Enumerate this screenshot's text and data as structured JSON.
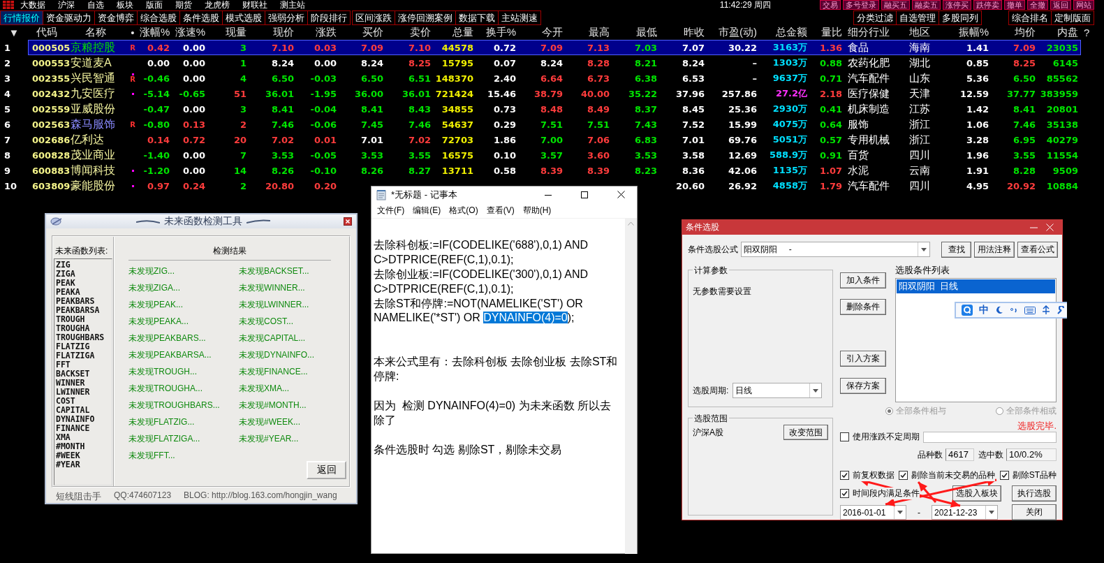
{
  "top_bar": {
    "menu": [
      "大数据",
      "沪深",
      "自选",
      "板块",
      "版面",
      "期货",
      "龙虎榜",
      "财联社",
      "测主站"
    ],
    "clock": "11:42:29 周四",
    "actions": [
      "交易",
      "多号登录",
      "融买五",
      "融卖五",
      "涨停买",
      "跌停卖",
      "撤单",
      "全撤",
      "返回",
      "网站"
    ]
  },
  "tab_groups": [
    [
      {
        "label": "行情报价",
        "selected": true
      },
      {
        "label": "资金驱动力",
        "selected": false
      },
      {
        "label": "资金博弈",
        "selected": false
      },
      {
        "label": "综合选股",
        "selected": false
      },
      {
        "label": "条件选股",
        "selected": false
      },
      {
        "label": "模式选股",
        "selected": false
      },
      {
        "label": "强弱分析",
        "selected": false
      },
      {
        "label": "阶段排行",
        "selected": false
      }
    ],
    [
      {
        "label": "区间涨跌",
        "selected": false
      },
      {
        "label": "涨停回溯案例",
        "selected": false
      },
      {
        "label": "数据下载",
        "selected": false
      },
      {
        "label": "主站测速",
        "selected": false
      }
    ],
    [
      {
        "label": "分类过滤",
        "selected": false
      },
      {
        "label": "自选管理",
        "selected": false
      },
      {
        "label": "多股同列",
        "selected": false
      }
    ],
    [
      {
        "label": "综合排名",
        "selected": false
      },
      {
        "label": "定制版面",
        "selected": false
      }
    ]
  ],
  "table": {
    "columns": [
      "▼",
      "代码",
      "名称",
      "•",
      "涨幅%",
      "涨速%",
      "现量",
      "现价",
      "涨跌",
      "买价",
      "卖价",
      "总量",
      "换手%",
      "今开",
      "最高",
      "最低",
      "昨收",
      "市盈(动)",
      "总金额",
      "量比",
      "细分行业",
      "地区",
      "振幅%",
      "均价",
      "内盘"
    ],
    "help_mark": "?",
    "rows": [
      {
        "selected": true,
        "dot": false,
        "cells": [
          {
            "text": "1",
            "kind": "plain"
          },
          {
            "text": "000505",
            "kind": "code"
          },
          {
            "text": "京粮控股",
            "kind": "down"
          },
          {
            "text": "R",
            "kind": "flag"
          },
          {
            "text": "0.42",
            "kind": "up"
          },
          {
            "text": "0.00",
            "kind": "plain"
          },
          {
            "text": "3",
            "kind": "down"
          },
          {
            "text": "7.10",
            "kind": "up"
          },
          {
            "text": "0.03",
            "kind": "up"
          },
          {
            "text": "7.09",
            "kind": "up"
          },
          {
            "text": "7.10",
            "kind": "up"
          },
          {
            "text": "44578",
            "kind": "vol"
          },
          {
            "text": "0.72",
            "kind": "plain"
          },
          {
            "text": "7.09",
            "kind": "up"
          },
          {
            "text": "7.13",
            "kind": "up"
          },
          {
            "text": "7.03",
            "kind": "down"
          },
          {
            "text": "7.07",
            "kind": "plain"
          },
          {
            "text": "30.22",
            "kind": "plain"
          },
          {
            "text": "3163万",
            "kind": "amt"
          },
          {
            "text": "1.36",
            "kind": "up"
          },
          {
            "text": "食品",
            "kind": "plain"
          },
          {
            "text": "海南",
            "kind": "plain"
          },
          {
            "text": "1.41",
            "kind": "plain"
          },
          {
            "text": "7.09",
            "kind": "up"
          },
          {
            "text": "23035",
            "kind": "down"
          }
        ]
      },
      {
        "selected": false,
        "dot": false,
        "cells": [
          {
            "text": "2",
            "kind": "plain"
          },
          {
            "text": "000553",
            "kind": "code"
          },
          {
            "text": "安道麦A",
            "kind": "name"
          },
          null,
          {
            "text": "0.00",
            "kind": "plain"
          },
          {
            "text": "0.00",
            "kind": "plain"
          },
          {
            "text": "1",
            "kind": "down"
          },
          {
            "text": "8.24",
            "kind": "plain"
          },
          {
            "text": "0.00",
            "kind": "plain"
          },
          {
            "text": "8.24",
            "kind": "plain"
          },
          {
            "text": "8.25",
            "kind": "up"
          },
          {
            "text": "15795",
            "kind": "vol"
          },
          {
            "text": "0.07",
            "kind": "plain"
          },
          {
            "text": "8.24",
            "kind": "plain"
          },
          {
            "text": "8.28",
            "kind": "up"
          },
          {
            "text": "8.21",
            "kind": "down"
          },
          {
            "text": "8.24",
            "kind": "plain"
          },
          {
            "text": "–",
            "kind": "plain"
          },
          {
            "text": "1303万",
            "kind": "amt"
          },
          {
            "text": "0.88",
            "kind": "down"
          },
          {
            "text": "农药化肥",
            "kind": "plain"
          },
          {
            "text": "湖北",
            "kind": "plain"
          },
          {
            "text": "0.85",
            "kind": "plain"
          },
          {
            "text": "8.25",
            "kind": "up"
          },
          {
            "text": "6145",
            "kind": "down"
          }
        ]
      },
      {
        "selected": false,
        "dot": true,
        "cells": [
          {
            "text": "3",
            "kind": "plain"
          },
          {
            "text": "002355",
            "kind": "code"
          },
          {
            "text": "兴民智通",
            "kind": "name"
          },
          {
            "text": "R",
            "kind": "flag"
          },
          {
            "text": "-0.46",
            "kind": "down"
          },
          {
            "text": "0.00",
            "kind": "plain"
          },
          {
            "text": "4",
            "kind": "down"
          },
          {
            "text": "6.50",
            "kind": "down"
          },
          {
            "text": "-0.03",
            "kind": "down"
          },
          {
            "text": "6.50",
            "kind": "down"
          },
          {
            "text": "6.51",
            "kind": "down"
          },
          {
            "text": "148370",
            "kind": "vol"
          },
          {
            "text": "2.40",
            "kind": "plain"
          },
          {
            "text": "6.64",
            "kind": "up"
          },
          {
            "text": "6.73",
            "kind": "up"
          },
          {
            "text": "6.38",
            "kind": "down"
          },
          {
            "text": "6.53",
            "kind": "plain"
          },
          {
            "text": "–",
            "kind": "plain"
          },
          {
            "text": "9637万",
            "kind": "amt"
          },
          {
            "text": "0.71",
            "kind": "down"
          },
          {
            "text": "汽车配件",
            "kind": "plain"
          },
          {
            "text": "山东",
            "kind": "plain"
          },
          {
            "text": "5.36",
            "kind": "plain"
          },
          {
            "text": "6.50",
            "kind": "down"
          },
          {
            "text": "85562",
            "kind": "down"
          }
        ]
      },
      {
        "selected": false,
        "dot": true,
        "cells": [
          {
            "text": "4",
            "kind": "plain"
          },
          {
            "text": "002432",
            "kind": "code"
          },
          {
            "text": "九安医疗",
            "kind": "name"
          },
          null,
          {
            "text": "-5.14",
            "kind": "down"
          },
          {
            "text": "-0.65",
            "kind": "down"
          },
          {
            "text": "51",
            "kind": "up"
          },
          {
            "text": "36.01",
            "kind": "down"
          },
          {
            "text": "-1.95",
            "kind": "down"
          },
          {
            "text": "36.00",
            "kind": "down"
          },
          {
            "text": "36.01",
            "kind": "down"
          },
          {
            "text": "721424",
            "kind": "vol"
          },
          {
            "text": "15.46",
            "kind": "plain"
          },
          {
            "text": "38.79",
            "kind": "up"
          },
          {
            "text": "40.00",
            "kind": "up"
          },
          {
            "text": "35.22",
            "kind": "down"
          },
          {
            "text": "37.96",
            "kind": "plain"
          },
          {
            "text": "257.86",
            "kind": "plain"
          },
          {
            "text": "27.2亿",
            "kind": "hot"
          },
          {
            "text": "2.18",
            "kind": "up"
          },
          {
            "text": "医疗保健",
            "kind": "plain"
          },
          {
            "text": "天津",
            "kind": "plain"
          },
          {
            "text": "12.59",
            "kind": "plain"
          },
          {
            "text": "37.77",
            "kind": "down"
          },
          {
            "text": "383959",
            "kind": "down"
          }
        ]
      },
      {
        "selected": false,
        "dot": false,
        "cells": [
          {
            "text": "5",
            "kind": "plain"
          },
          {
            "text": "002559",
            "kind": "code"
          },
          {
            "text": "亚威股份",
            "kind": "name"
          },
          null,
          {
            "text": "-0.47",
            "kind": "down"
          },
          {
            "text": "0.00",
            "kind": "plain"
          },
          {
            "text": "3",
            "kind": "down"
          },
          {
            "text": "8.41",
            "kind": "down"
          },
          {
            "text": "-0.04",
            "kind": "down"
          },
          {
            "text": "8.41",
            "kind": "down"
          },
          {
            "text": "8.43",
            "kind": "down"
          },
          {
            "text": "34855",
            "kind": "vol"
          },
          {
            "text": "0.73",
            "kind": "plain"
          },
          {
            "text": "8.48",
            "kind": "up"
          },
          {
            "text": "8.49",
            "kind": "up"
          },
          {
            "text": "8.37",
            "kind": "down"
          },
          {
            "text": "8.45",
            "kind": "plain"
          },
          {
            "text": "25.36",
            "kind": "plain"
          },
          {
            "text": "2930万",
            "kind": "amt"
          },
          {
            "text": "0.41",
            "kind": "down"
          },
          {
            "text": "机床制造",
            "kind": "plain"
          },
          {
            "text": "江苏",
            "kind": "plain"
          },
          {
            "text": "1.42",
            "kind": "plain"
          },
          {
            "text": "8.41",
            "kind": "down"
          },
          {
            "text": "20801",
            "kind": "down"
          }
        ]
      },
      {
        "selected": false,
        "dot": false,
        "cells": [
          {
            "text": "6",
            "kind": "plain"
          },
          {
            "text": "002563",
            "kind": "code"
          },
          {
            "text": "森马服饰",
            "kind": "link"
          },
          {
            "text": "R",
            "kind": "flag"
          },
          {
            "text": "-0.80",
            "kind": "down"
          },
          {
            "text": "0.13",
            "kind": "up"
          },
          {
            "text": "2",
            "kind": "up"
          },
          {
            "text": "7.46",
            "kind": "down"
          },
          {
            "text": "-0.06",
            "kind": "down"
          },
          {
            "text": "7.45",
            "kind": "down"
          },
          {
            "text": "7.46",
            "kind": "down"
          },
          {
            "text": "54637",
            "kind": "vol"
          },
          {
            "text": "0.29",
            "kind": "plain"
          },
          {
            "text": "7.51",
            "kind": "down"
          },
          {
            "text": "7.51",
            "kind": "down"
          },
          {
            "text": "7.43",
            "kind": "down"
          },
          {
            "text": "7.52",
            "kind": "plain"
          },
          {
            "text": "15.99",
            "kind": "plain"
          },
          {
            "text": "4075万",
            "kind": "amt"
          },
          {
            "text": "0.64",
            "kind": "down"
          },
          {
            "text": "服饰",
            "kind": "plain"
          },
          {
            "text": "浙江",
            "kind": "plain"
          },
          {
            "text": "1.06",
            "kind": "plain"
          },
          {
            "text": "7.46",
            "kind": "down"
          },
          {
            "text": "35138",
            "kind": "down"
          }
        ]
      },
      {
        "selected": false,
        "dot": false,
        "cells": [
          {
            "text": "7",
            "kind": "plain"
          },
          {
            "text": "002686",
            "kind": "code"
          },
          {
            "text": "亿利达",
            "kind": "name"
          },
          null,
          {
            "text": "0.14",
            "kind": "up"
          },
          {
            "text": "0.72",
            "kind": "up"
          },
          {
            "text": "20",
            "kind": "up"
          },
          {
            "text": "7.02",
            "kind": "up"
          },
          {
            "text": "0.01",
            "kind": "up"
          },
          {
            "text": "7.01",
            "kind": "plain"
          },
          {
            "text": "7.02",
            "kind": "up"
          },
          {
            "text": "72703",
            "kind": "vol"
          },
          {
            "text": "1.86",
            "kind": "plain"
          },
          {
            "text": "7.00",
            "kind": "down"
          },
          {
            "text": "7.06",
            "kind": "up"
          },
          {
            "text": "6.83",
            "kind": "down"
          },
          {
            "text": "7.01",
            "kind": "plain"
          },
          {
            "text": "69.76",
            "kind": "plain"
          },
          {
            "text": "5051万",
            "kind": "amt"
          },
          {
            "text": "0.57",
            "kind": "down"
          },
          {
            "text": "专用机械",
            "kind": "plain"
          },
          {
            "text": "浙江",
            "kind": "plain"
          },
          {
            "text": "3.28",
            "kind": "plain"
          },
          {
            "text": "6.95",
            "kind": "down"
          },
          {
            "text": "40279",
            "kind": "down"
          }
        ]
      },
      {
        "selected": false,
        "dot": false,
        "cells": [
          {
            "text": "8",
            "kind": "plain"
          },
          {
            "text": "600828",
            "kind": "code"
          },
          {
            "text": "茂业商业",
            "kind": "name"
          },
          null,
          {
            "text": "-1.40",
            "kind": "down"
          },
          {
            "text": "0.00",
            "kind": "plain"
          },
          {
            "text": "7",
            "kind": "down"
          },
          {
            "text": "3.53",
            "kind": "down"
          },
          {
            "text": "-0.05",
            "kind": "down"
          },
          {
            "text": "3.53",
            "kind": "down"
          },
          {
            "text": "3.55",
            "kind": "down"
          },
          {
            "text": "16575",
            "kind": "vol"
          },
          {
            "text": "0.10",
            "kind": "plain"
          },
          {
            "text": "3.57",
            "kind": "down"
          },
          {
            "text": "3.60",
            "kind": "up"
          },
          {
            "text": "3.53",
            "kind": "down"
          },
          {
            "text": "3.58",
            "kind": "plain"
          },
          {
            "text": "12.69",
            "kind": "plain"
          },
          {
            "text": "588.9万",
            "kind": "amt"
          },
          {
            "text": "0.91",
            "kind": "down"
          },
          {
            "text": "百货",
            "kind": "plain"
          },
          {
            "text": "四川",
            "kind": "plain"
          },
          {
            "text": "1.96",
            "kind": "plain"
          },
          {
            "text": "3.55",
            "kind": "down"
          },
          {
            "text": "11554",
            "kind": "down"
          }
        ]
      },
      {
        "selected": false,
        "dot": true,
        "cells": [
          {
            "text": "9",
            "kind": "plain"
          },
          {
            "text": "600883",
            "kind": "code"
          },
          {
            "text": "博闻科技",
            "kind": "name"
          },
          null,
          {
            "text": "-1.20",
            "kind": "down"
          },
          {
            "text": "0.00",
            "kind": "plain"
          },
          {
            "text": "14",
            "kind": "down"
          },
          {
            "text": "8.26",
            "kind": "down"
          },
          {
            "text": "-0.10",
            "kind": "down"
          },
          {
            "text": "8.26",
            "kind": "down"
          },
          {
            "text": "8.27",
            "kind": "down"
          },
          {
            "text": "13711",
            "kind": "vol"
          },
          {
            "text": "0.58",
            "kind": "plain"
          },
          {
            "text": "8.39",
            "kind": "up"
          },
          {
            "text": "8.39",
            "kind": "up"
          },
          {
            "text": "8.23",
            "kind": "down"
          },
          {
            "text": "8.36",
            "kind": "plain"
          },
          {
            "text": "42.06",
            "kind": "plain"
          },
          {
            "text": "1135万",
            "kind": "amt"
          },
          {
            "text": "1.07",
            "kind": "up"
          },
          {
            "text": "水泥",
            "kind": "plain"
          },
          {
            "text": "云南",
            "kind": "plain"
          },
          {
            "text": "1.91",
            "kind": "plain"
          },
          {
            "text": "8.28",
            "kind": "down"
          },
          {
            "text": "9509",
            "kind": "down"
          }
        ]
      },
      {
        "selected": false,
        "dot": true,
        "cells": [
          {
            "text": "10",
            "kind": "plain"
          },
          {
            "text": "603809",
            "kind": "code"
          },
          {
            "text": "豪能股份",
            "kind": "name"
          },
          null,
          {
            "text": "0.97",
            "kind": "up"
          },
          {
            "text": "0.24",
            "kind": "up"
          },
          {
            "text": "2",
            "kind": "down"
          },
          {
            "text": "20.80",
            "kind": "up"
          },
          {
            "text": "0.20",
            "kind": "up"
          },
          null,
          null,
          null,
          null,
          null,
          null,
          null,
          {
            "text": "20.60",
            "kind": "plain"
          },
          {
            "text": "26.92",
            "kind": "plain"
          },
          {
            "text": "4858万",
            "kind": "amt"
          },
          {
            "text": "1.79",
            "kind": "up"
          },
          {
            "text": "汽车配件",
            "kind": "plain"
          },
          {
            "text": "四川",
            "kind": "plain"
          },
          {
            "text": "4.95",
            "kind": "plain"
          },
          {
            "text": "20.92",
            "kind": "up"
          },
          {
            "text": "10884",
            "kind": "down"
          }
        ]
      }
    ]
  },
  "tool_window": {
    "title": "未来函数检测工具",
    "list_label": "未来函数列表:",
    "functions": [
      "ZIG",
      "ZIGA",
      "PEAK",
      "PEAKA",
      "PEAKBARS",
      "PEAKBARSA",
      "TROUGH",
      "TROUGHA",
      "TROUGHBARS",
      "FLATZIG",
      "FLATZIGA",
      "FFT",
      "BACKSET",
      "WINNER",
      "LWINNER",
      "COST",
      "CAPITAL",
      "DYNAINFO",
      "FINANCE",
      "XMA",
      "#MONTH",
      "#WEEK",
      "#YEAR"
    ],
    "results_title": "检测结果",
    "results": [
      "未发现ZIG...",
      "未发现ZIGA...",
      "未发现PEAK...",
      "未发现PEAKA...",
      "未发现PEAKBARS...",
      "未发现PEAKBARSA...",
      "未发现TROUGH...",
      "未发现TROUGHA...",
      "未发现TROUGHBARS...",
      "未发现FLATZIG...",
      "未发现FLATZIGA...",
      "未发现FFT...",
      "未发现BACKSET...",
      "未发现WINNER...",
      "未发现LWINNER...",
      "未发现COST...",
      "未发现CAPITAL...",
      "未发现DYNAINFO...",
      "未发现FINANCE...",
      "未发现XMA...",
      "未发现#MONTH...",
      "未发现#WEEK...",
      "未发现#YEAR..."
    ],
    "button": "返回",
    "footer": [
      "短线阻击手",
      "QQ:474607123",
      "BLOG: http://blog.163.com/hongjin_wang"
    ]
  },
  "notepad": {
    "title": "*无标题 - 记事本",
    "menu": [
      "文件(F)",
      "编辑(E)",
      "格式(O)",
      "查看(V)",
      "帮助(H)"
    ],
    "lines": [
      {
        "kind": "blank"
      },
      {
        "kind": "text",
        "segments": [
          {
            "text": "去除科创板:=IF(CODELIKE('688'),0,1) AND C>DTPRICE(REF(C,1),0.1);",
            "selected": false
          }
        ]
      },
      {
        "kind": "text",
        "segments": [
          {
            "text": "去除创业板:=IF(CODELIKE('300'),0,1) AND C>DTPRICE(REF(C,1),0.1);",
            "selected": false
          }
        ]
      },
      {
        "kind": "text",
        "segments": [
          {
            "text": "去除ST和停牌:=NOT(NAMELIKE('ST') OR NAMELIKE('*ST') OR ",
            "selected": false
          },
          {
            "text": "DYNAINFO(4)=0",
            "selected": true
          },
          {
            "text": ");",
            "selected": false
          }
        ]
      },
      {
        "kind": "blank"
      },
      {
        "kind": "blank"
      },
      {
        "kind": "text",
        "segments": [
          {
            "text": "本来公式里有：去除科创板 去除创业板 去除ST和停牌:",
            "selected": false
          }
        ]
      },
      {
        "kind": "blank"
      },
      {
        "kind": "text",
        "segments": [
          {
            "text": "因为  检测 DYNAINFO(4)=0) 为未来函数 所以去除了",
            "selected": false
          }
        ]
      },
      {
        "kind": "blank"
      },
      {
        "kind": "text",
        "segments": [
          {
            "text": "条件选股时 勾选 剔除ST，剔除未交易",
            "selected": false
          }
        ]
      }
    ]
  },
  "dialog": {
    "title": "条件选股",
    "formula_label": "条件选股公式",
    "formula": "阳双阴阳     -",
    "top_buttons": [
      "查找",
      "用法注释",
      "查看公式"
    ],
    "params": {
      "title": "计算参数",
      "message": "无参数需要设置",
      "period_label": "选股周期:",
      "period": "日线"
    },
    "side_buttons": [
      "加入条件",
      "删除条件",
      "引入方案",
      "保存方案"
    ],
    "list_label": "选股条件列表",
    "list_items": [
      {
        "label": "阳双阴阳  日线",
        "selected": true
      }
    ],
    "combine_disabled": true,
    "combine": [
      {
        "label": "全部条件相与",
        "selected": true
      },
      {
        "label": "全部条件相或",
        "selected": false
      }
    ],
    "status": "选股完毕.",
    "scope": {
      "title": "选股范围",
      "value": "沪深A股",
      "button": "改变范围"
    },
    "variable_period": {
      "label": "使用涨跌不定周期",
      "checked": false
    },
    "count_label": "品种数",
    "count": "4617",
    "picked_label": "选中数",
    "picked": "10/0.2%",
    "options": [
      {
        "label": "前复权数据",
        "checked": true
      },
      {
        "label": "剔除当前未交易的品种",
        "checked": true
      },
      {
        "label": "剔除ST品种",
        "checked": true
      }
    ],
    "range_option": {
      "label": "时间段内满足条件",
      "checked": true
    },
    "action_buttons": [
      "选股入板块",
      "执行选股",
      "关闭"
    ],
    "date_from": "2016-01-01",
    "date_separator": "-",
    "date_to": "2021-12-23"
  },
  "ime_toolbar": {
    "mode": "中"
  }
}
